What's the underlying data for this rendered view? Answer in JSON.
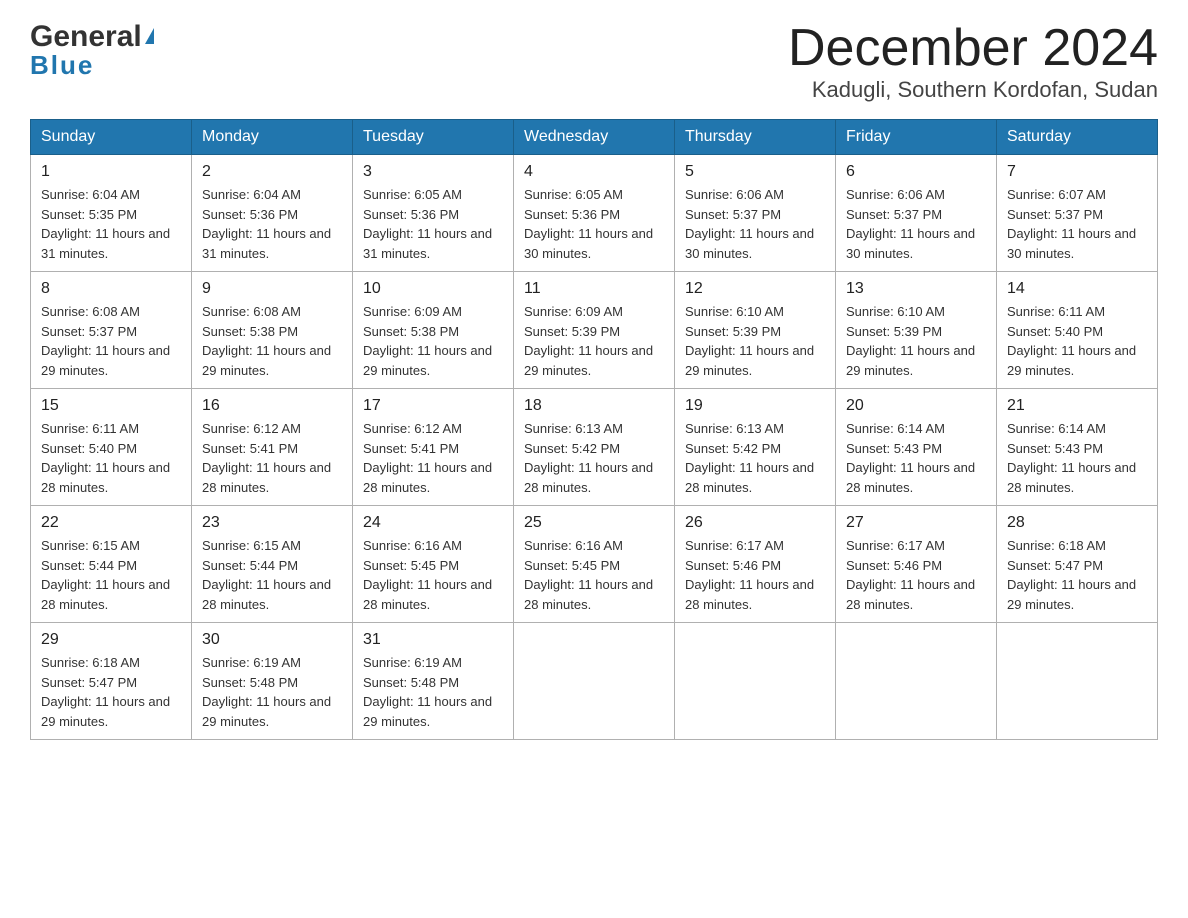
{
  "logo": {
    "text_general": "General",
    "triangle": "▶",
    "text_blue": "Blue"
  },
  "header": {
    "month": "December 2024",
    "location": "Kadugli, Southern Kordofan, Sudan"
  },
  "days_of_week": [
    "Sunday",
    "Monday",
    "Tuesday",
    "Wednesday",
    "Thursday",
    "Friday",
    "Saturday"
  ],
  "weeks": [
    [
      {
        "num": "1",
        "sunrise": "6:04 AM",
        "sunset": "5:35 PM",
        "daylight": "11 hours and 31 minutes."
      },
      {
        "num": "2",
        "sunrise": "6:04 AM",
        "sunset": "5:36 PM",
        "daylight": "11 hours and 31 minutes."
      },
      {
        "num": "3",
        "sunrise": "6:05 AM",
        "sunset": "5:36 PM",
        "daylight": "11 hours and 31 minutes."
      },
      {
        "num": "4",
        "sunrise": "6:05 AM",
        "sunset": "5:36 PM",
        "daylight": "11 hours and 30 minutes."
      },
      {
        "num": "5",
        "sunrise": "6:06 AM",
        "sunset": "5:37 PM",
        "daylight": "11 hours and 30 minutes."
      },
      {
        "num": "6",
        "sunrise": "6:06 AM",
        "sunset": "5:37 PM",
        "daylight": "11 hours and 30 minutes."
      },
      {
        "num": "7",
        "sunrise": "6:07 AM",
        "sunset": "5:37 PM",
        "daylight": "11 hours and 30 minutes."
      }
    ],
    [
      {
        "num": "8",
        "sunrise": "6:08 AM",
        "sunset": "5:37 PM",
        "daylight": "11 hours and 29 minutes."
      },
      {
        "num": "9",
        "sunrise": "6:08 AM",
        "sunset": "5:38 PM",
        "daylight": "11 hours and 29 minutes."
      },
      {
        "num": "10",
        "sunrise": "6:09 AM",
        "sunset": "5:38 PM",
        "daylight": "11 hours and 29 minutes."
      },
      {
        "num": "11",
        "sunrise": "6:09 AM",
        "sunset": "5:39 PM",
        "daylight": "11 hours and 29 minutes."
      },
      {
        "num": "12",
        "sunrise": "6:10 AM",
        "sunset": "5:39 PM",
        "daylight": "11 hours and 29 minutes."
      },
      {
        "num": "13",
        "sunrise": "6:10 AM",
        "sunset": "5:39 PM",
        "daylight": "11 hours and 29 minutes."
      },
      {
        "num": "14",
        "sunrise": "6:11 AM",
        "sunset": "5:40 PM",
        "daylight": "11 hours and 29 minutes."
      }
    ],
    [
      {
        "num": "15",
        "sunrise": "6:11 AM",
        "sunset": "5:40 PM",
        "daylight": "11 hours and 28 minutes."
      },
      {
        "num": "16",
        "sunrise": "6:12 AM",
        "sunset": "5:41 PM",
        "daylight": "11 hours and 28 minutes."
      },
      {
        "num": "17",
        "sunrise": "6:12 AM",
        "sunset": "5:41 PM",
        "daylight": "11 hours and 28 minutes."
      },
      {
        "num": "18",
        "sunrise": "6:13 AM",
        "sunset": "5:42 PM",
        "daylight": "11 hours and 28 minutes."
      },
      {
        "num": "19",
        "sunrise": "6:13 AM",
        "sunset": "5:42 PM",
        "daylight": "11 hours and 28 minutes."
      },
      {
        "num": "20",
        "sunrise": "6:14 AM",
        "sunset": "5:43 PM",
        "daylight": "11 hours and 28 minutes."
      },
      {
        "num": "21",
        "sunrise": "6:14 AM",
        "sunset": "5:43 PM",
        "daylight": "11 hours and 28 minutes."
      }
    ],
    [
      {
        "num": "22",
        "sunrise": "6:15 AM",
        "sunset": "5:44 PM",
        "daylight": "11 hours and 28 minutes."
      },
      {
        "num": "23",
        "sunrise": "6:15 AM",
        "sunset": "5:44 PM",
        "daylight": "11 hours and 28 minutes."
      },
      {
        "num": "24",
        "sunrise": "6:16 AM",
        "sunset": "5:45 PM",
        "daylight": "11 hours and 28 minutes."
      },
      {
        "num": "25",
        "sunrise": "6:16 AM",
        "sunset": "5:45 PM",
        "daylight": "11 hours and 28 minutes."
      },
      {
        "num": "26",
        "sunrise": "6:17 AM",
        "sunset": "5:46 PM",
        "daylight": "11 hours and 28 minutes."
      },
      {
        "num": "27",
        "sunrise": "6:17 AM",
        "sunset": "5:46 PM",
        "daylight": "11 hours and 28 minutes."
      },
      {
        "num": "28",
        "sunrise": "6:18 AM",
        "sunset": "5:47 PM",
        "daylight": "11 hours and 29 minutes."
      }
    ],
    [
      {
        "num": "29",
        "sunrise": "6:18 AM",
        "sunset": "5:47 PM",
        "daylight": "11 hours and 29 minutes."
      },
      {
        "num": "30",
        "sunrise": "6:19 AM",
        "sunset": "5:48 PM",
        "daylight": "11 hours and 29 minutes."
      },
      {
        "num": "31",
        "sunrise": "6:19 AM",
        "sunset": "5:48 PM",
        "daylight": "11 hours and 29 minutes."
      },
      null,
      null,
      null,
      null
    ]
  ]
}
